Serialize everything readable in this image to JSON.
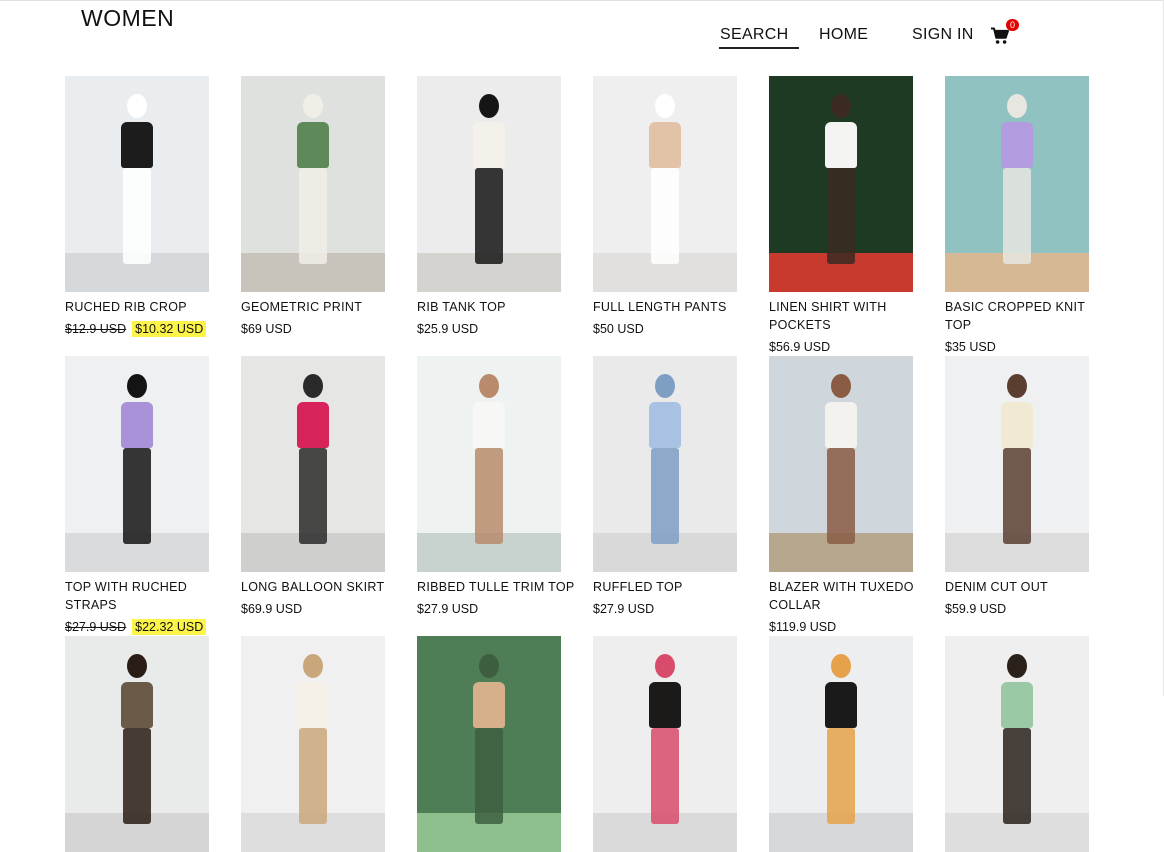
{
  "header": {
    "brand": "WOMEN",
    "nav": {
      "search": "SEARCH",
      "home": "HOME",
      "sign_in": "SIGN IN"
    },
    "cart_count": "0"
  },
  "products": [
    {
      "name": "RUCHED RIB CROP",
      "old_price": "$12.9 USD",
      "price": "$10.32 USD",
      "on_sale": true,
      "palette": [
        "#e9edf0",
        "#d6d9db",
        "#1c1c1c",
        "#ffffff"
      ]
    },
    {
      "name": "GEOMETRIC PRINT",
      "price": "$69 USD",
      "on_sale": false,
      "palette": [
        "#dfe1df",
        "#c9c4bb",
        "#5e8a5a",
        "#f0efe7"
      ]
    },
    {
      "name": "RIB TANK TOP",
      "price": "$25.9 USD",
      "on_sale": false,
      "palette": [
        "#ececec",
        "#d5d3d0",
        "#f3f1ea",
        "#151515"
      ]
    },
    {
      "name": "FULL LENGTH PANTS",
      "price": "$50 USD",
      "on_sale": false,
      "palette": [
        "#efefef",
        "#e2e0de",
        "#e2c3a8",
        "#ffffff"
      ]
    },
    {
      "name": "LINEN SHIRT WITH POCKETS",
      "price": "$56.9 USD",
      "on_sale": false,
      "palette": [
        "#1f3a22",
        "#c83a2e",
        "#f4f4f2",
        "#3a2a22"
      ]
    },
    {
      "name": "BASIC CROPPED KNIT TOP",
      "price": "$35 USD",
      "on_sale": false,
      "palette": [
        "#8fc2c0",
        "#d7b894",
        "#b39be0",
        "#e8e6e0"
      ]
    },
    {
      "name": "TOP WITH RUCHED STRAPS",
      "old_price": "$27.9 USD",
      "price": "$22.32 USD",
      "on_sale": true,
      "palette": [
        "#eef0f2",
        "#d9dbdd",
        "#a992d8",
        "#141414"
      ]
    },
    {
      "name": "LONG BALLOON SKIRT",
      "price": "$69.9 USD",
      "on_sale": false,
      "palette": [
        "#e6e6e4",
        "#cfcfcd",
        "#d8235a",
        "#2a2a2a"
      ]
    },
    {
      "name": "RIBBED TULLE TRIM TOP",
      "price": "$27.9 USD",
      "on_sale": false,
      "palette": [
        "#eef3f2",
        "#c8d2cf",
        "#f7f7f5",
        "#b98b6c"
      ]
    },
    {
      "name": "RUFFLED TOP",
      "price": "$27.9 USD",
      "on_sale": false,
      "palette": [
        "#eaeaea",
        "#d9d9d9",
        "#a9c2e3",
        "#7f9ec4"
      ]
    },
    {
      "name": "BLAZER WITH TUXEDO COLLAR",
      "price": "$119.9 USD",
      "on_sale": false,
      "palette": [
        "#cfd6dc",
        "#b7a78f",
        "#f4f2ee",
        "#8a5c44"
      ]
    },
    {
      "name": "DENIM CUT OUT",
      "price": "$59.9 USD",
      "on_sale": false,
      "palette": [
        "#eff0f1",
        "#dcdcdc",
        "#f1ead2",
        "#5a3e30"
      ]
    },
    {
      "name": "",
      "price": "",
      "on_sale": false,
      "palette": [
        "#e9eaea",
        "#d5d5d5",
        "#6c5a48",
        "#2a1d15"
      ]
    },
    {
      "name": "",
      "price": "",
      "on_sale": false,
      "palette": [
        "#f0f0f0",
        "#dedede",
        "#f4f0e8",
        "#caa77b"
      ]
    },
    {
      "name": "",
      "price": "",
      "on_sale": false,
      "palette": [
        "#4f7e56",
        "#8fbf8c",
        "#d6b08a",
        "#3d5f3f"
      ]
    },
    {
      "name": "",
      "price": "",
      "on_sale": false,
      "palette": [
        "#eeeeee",
        "#dadada",
        "#1c1a18",
        "#d94b6a"
      ]
    },
    {
      "name": "",
      "price": "",
      "on_sale": false,
      "palette": [
        "#eceeef",
        "#d7d8d9",
        "#1a1a1a",
        "#e6a24a"
      ]
    },
    {
      "name": "",
      "price": "",
      "on_sale": false,
      "palette": [
        "#efefef",
        "#dedede",
        "#9bc9a6",
        "#2a211b"
      ]
    }
  ]
}
